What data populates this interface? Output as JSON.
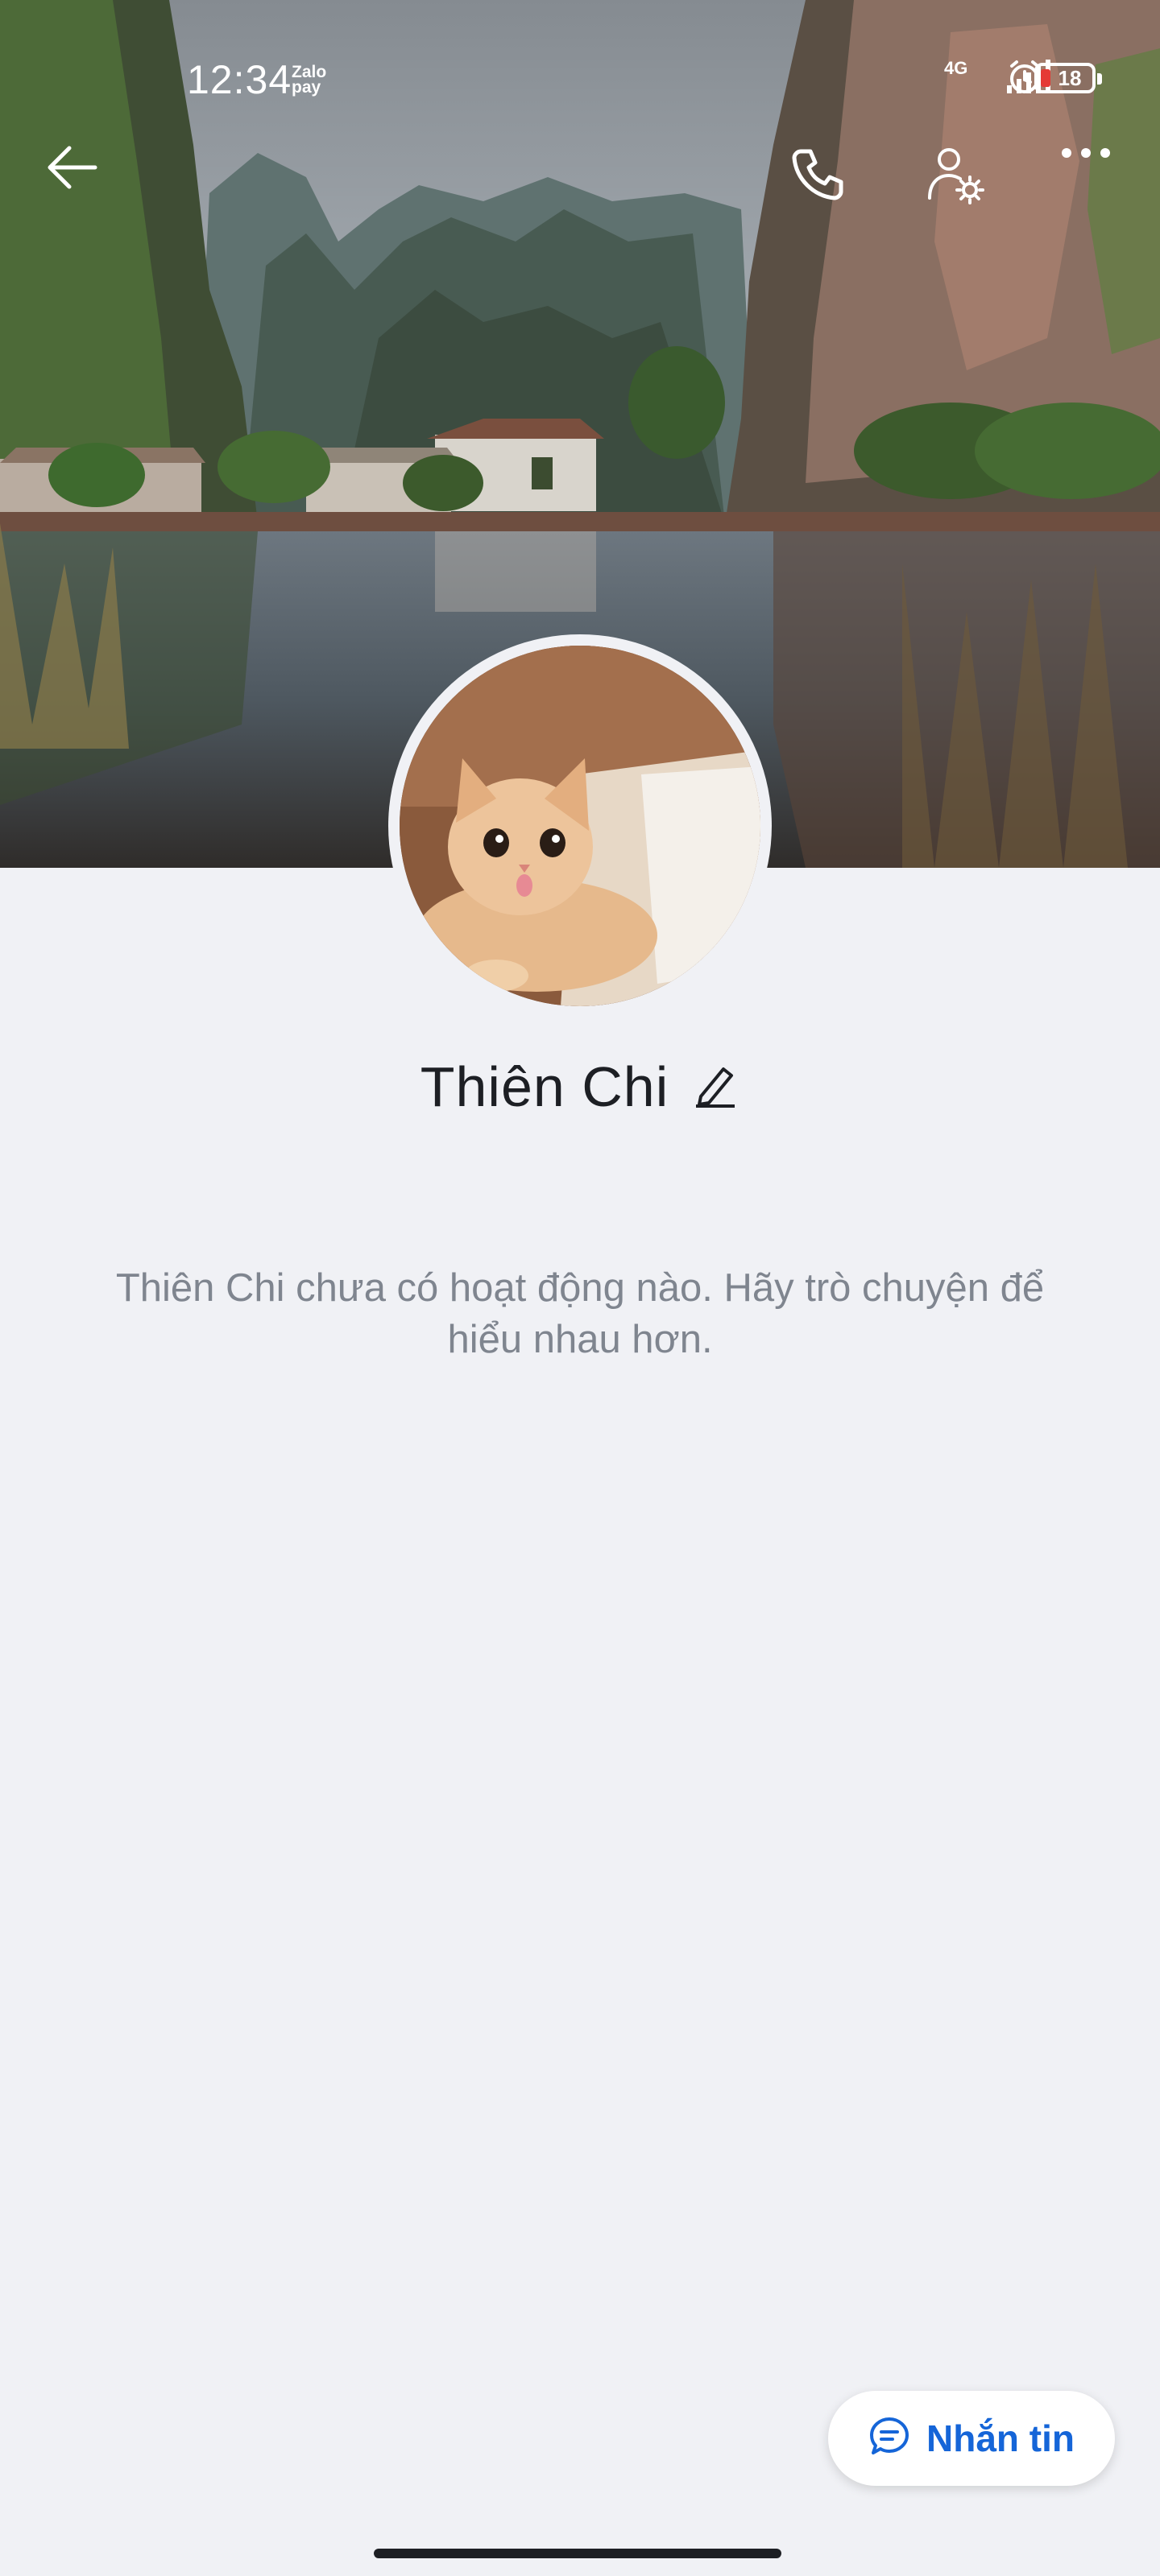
{
  "status_bar": {
    "time": "12:34",
    "zalopay": "Zalo pay",
    "network": "4G",
    "battery": "18"
  },
  "header": {
    "back_icon": "arrow-left-icon",
    "call_icon": "phone-icon",
    "settings_icon": "user-settings-icon",
    "more_icon": "more-dots-icon"
  },
  "profile": {
    "name": "Thiên Chi",
    "edit_icon": "pencil-icon",
    "empty_activity": "Thiên Chi chưa có hoạt động nào. Hãy trò chuyện để hiểu nhau hơn."
  },
  "actions": {
    "message_label": "Nhắn tin",
    "message_icon": "chat-bubble-icon"
  },
  "colors": {
    "accent": "#1565d8",
    "background": "#f0f1f5",
    "text_primary": "#1d1f24",
    "text_secondary": "#7f858f",
    "battery_low": "#e53935"
  }
}
